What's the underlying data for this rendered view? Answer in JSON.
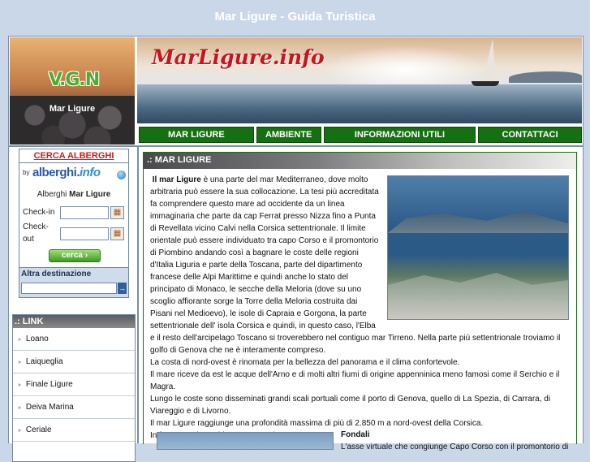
{
  "site_title": "Mar Ligure - Guida Turistica",
  "logo": {
    "badge": "V.G.N",
    "caption": "Mar Ligure"
  },
  "banner": {
    "title": "MarLigure.info"
  },
  "nav": [
    {
      "label": "MAR LIGURE"
    },
    {
      "label": "AMBIENTE"
    },
    {
      "label": "INFORMAZIONI UTILI"
    },
    {
      "label": "CONTATTACI"
    }
  ],
  "hotel": {
    "head": "CERCA ALBERGHI",
    "by": "by",
    "brand_main": "alberghi.",
    "brand_tail": "info",
    "city_prefix": "Alberghi",
    "city": "Mar Ligure",
    "checkin_label": "Check-in",
    "checkout_label1": "Check-",
    "checkout_label2": "out",
    "search_label": "cerca",
    "other_dest_label": "Altra destinazione"
  },
  "links": {
    "head": ".: LINK",
    "items": [
      {
        "label": "Loano"
      },
      {
        "label": "Laiqueglia"
      },
      {
        "label": "Finale Ligure"
      },
      {
        "label": "Deiva Marina"
      },
      {
        "label": "Ceriale"
      }
    ]
  },
  "main": {
    "section_label": ".: MAR LIGURE",
    "intro_bold": "Il mar Ligure",
    "intro_rest": " è una parte del mar Mediterraneo, dove molto arbitraria può essere la sua collocazione. La tesi più accreditata fa comprendere questo mare ad occidente da un linea immaginaria che parte da cap Ferrat presso Nizza fino a Punta di Revellata vicino Calvi nella Corsica settentrionale. Il limite orientale può essere individuato tra capo Corso e il promontorio di Piombino andando così a bagnare le coste delle regioni d'Italia Liguria e parte della Toscana, parte del dipartimento francese delle Alpi Marittime e quindi anche lo stato del principato di Monaco, le secche della Meloria (dove su uno scoglio affiorante sorge la Torre della Meloria costruita dai Pisani nel Medioevo), le isole di Capraia e Gorgona, la parte settentrionale dell' isola Corsica e quindi, in questo caso, l'Elba e il resto dell'arcipelago Toscano si troverebbero nel contiguo mar Tirreno. Nella parte più settentrionale troviamo il golfo di Genova che ne è interamente compreso.",
    "p2": "La costa di nord-ovest è rinomata per la bellezza del panorama e il clima confortevole.",
    "p3": "Il mare riceve da est le acque dell'Arno e di molti altri fiumi di origine appenninica meno famosi come il Serchio e il Magra.",
    "p4": "Lungo le coste sono disseminati grandi scali portuali come il porto di Genova, quello di La Spezia, di Carrara, di Viareggio e di Livorno.",
    "p5": "Il mar Ligure raggiunge una profondità massima di più di 2.850 m a nord-ovest della Corsica.",
    "p6": "In francese viene chiamato \"Mer Ligure\".",
    "fondali_title": "Fondali",
    "fondali_text": "L'asse virtuale che congiunge Capo Corso con il promontorio di"
  }
}
